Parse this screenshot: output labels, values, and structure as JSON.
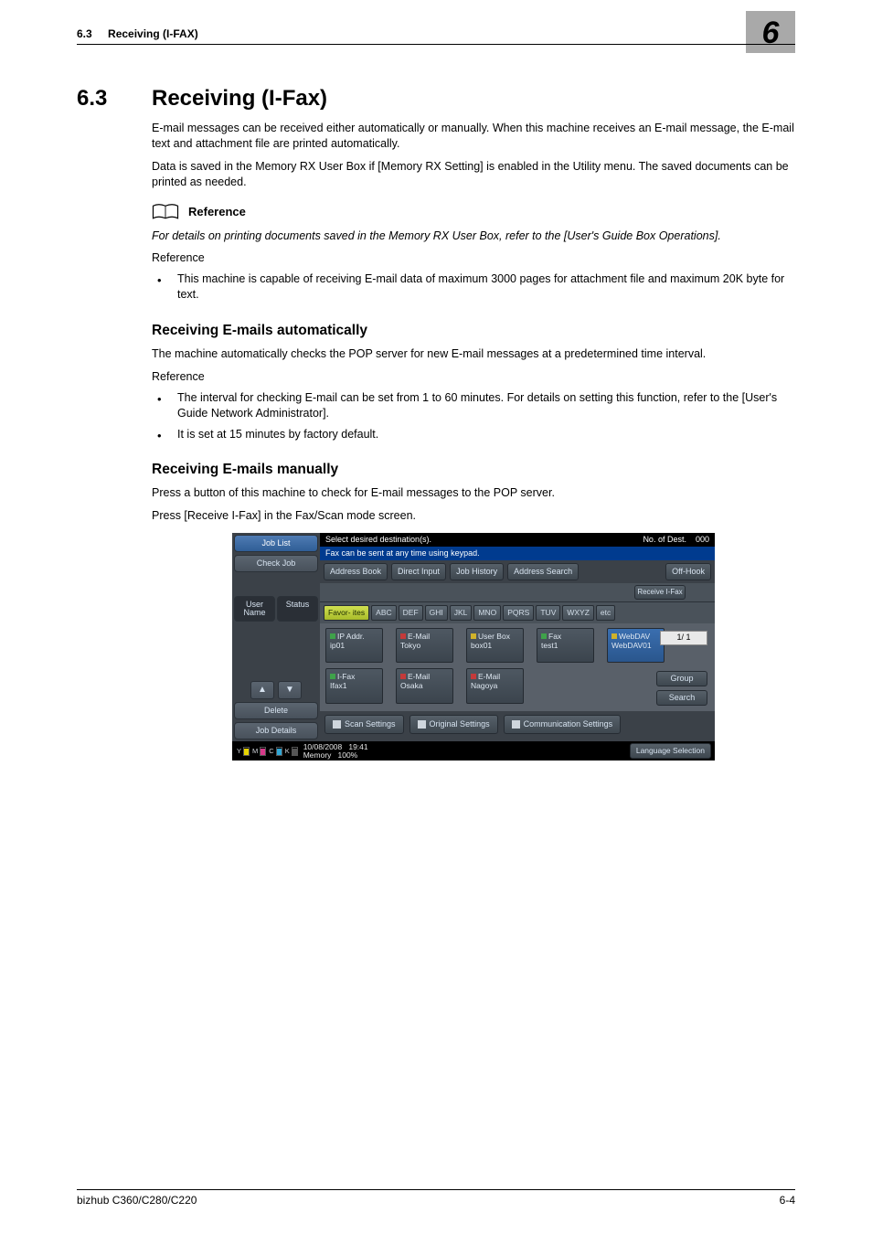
{
  "header": {
    "section_number": "6.3",
    "section_title": "Receiving (I-FAX)",
    "chapter_number": "6"
  },
  "h1": {
    "number": "6.3",
    "title": "Receiving (I-Fax)"
  },
  "intro": {
    "p1": "E-mail messages can be received either automatically or manually. When this machine receives an E-mail message, the E-mail text and attachment file are printed automatically.",
    "p2": "Data is saved in the Memory RX User Box if [Memory RX Setting] is enabled in the Utility menu. The saved documents can be printed as needed."
  },
  "reference_block": {
    "label": "Reference",
    "text": "For details on printing documents saved in the Memory RX User Box, refer to the [User's Guide Box Operations].",
    "word": "Reference",
    "bullets": [
      "This machine is capable of receiving E-mail data of maximum 3000 pages for attachment file and maximum 20K byte for text."
    ]
  },
  "auto": {
    "heading": "Receiving E-mails automatically",
    "p1": "The machine automatically checks the POP server for new E-mail messages at a predetermined time interval.",
    "word": "Reference",
    "bullets": [
      "The interval for checking E-mail can be set from 1 to 60 minutes. For details on setting this function, refer to the [User's Guide Network Administrator].",
      "It is set at 15 minutes by factory default."
    ]
  },
  "manual": {
    "heading": "Receiving E-mails manually",
    "p1": "Press a button of this machine to check for E-mail messages to the POP server.",
    "p2": "Press [Receive I-Fax] in the Fax/Scan mode screen."
  },
  "lcd": {
    "left": {
      "job_list": "Job List",
      "check_job": "Check Job",
      "user_name": "User Name",
      "status": "Status",
      "delete": "Delete",
      "job_details": "Job Details"
    },
    "top": {
      "msg1": "Select desired destination(s).",
      "no_of_dest": "No. of Dest.",
      "dest_count": "000",
      "msg2": "Fax can be sent at any time using keypad."
    },
    "tabs": {
      "address_book": "Address Book",
      "direct_input": "Direct Input",
      "job_history": "Job History",
      "address_search": "Address Search",
      "off_hook": "Off-Hook"
    },
    "receive_btn": "Receive I-Fax",
    "filters": [
      "Favor- ites",
      "ABC",
      "DEF",
      "GHI",
      "JKL",
      "MNO",
      "PQRS",
      "TUV",
      "WXYZ",
      "etc"
    ],
    "pager": "1/  1",
    "cards": [
      {
        "l1": "IP Addr.",
        "l2": "ip01"
      },
      {
        "l1": "E-Mail",
        "l2": "Tokyo"
      },
      {
        "l1": "User Box",
        "l2": "box01"
      },
      {
        "l1": "Fax",
        "l2": "test1"
      },
      {
        "l1": "WebDAV",
        "l2": "WebDAV01",
        "blue": true
      },
      {
        "l1": "I-Fax",
        "l2": "Ifax1"
      },
      {
        "l1": "E-Mail",
        "l2": "Osaka"
      },
      {
        "l1": "E-Mail",
        "l2": "Nagoya"
      }
    ],
    "right_btns": {
      "group": "Group",
      "search": "Search"
    },
    "bottom": {
      "scan_settings": "Scan Settings",
      "original_settings": "Original Settings",
      "comm_settings": "Communication Settings"
    },
    "status": {
      "date": "10/08/2008",
      "time": "19:41",
      "memory_label": "Memory",
      "memory_pct": "100%",
      "language": "Language Selection",
      "toners": [
        {
          "label": "Y",
          "color": "#e6d400"
        },
        {
          "label": "M",
          "color": "#d83a8a"
        },
        {
          "label": "C",
          "color": "#2fa7d6"
        },
        {
          "label": "K",
          "color": "#222"
        }
      ]
    }
  },
  "footer": {
    "left": "bizhub C360/C280/C220",
    "right": "6-4"
  }
}
